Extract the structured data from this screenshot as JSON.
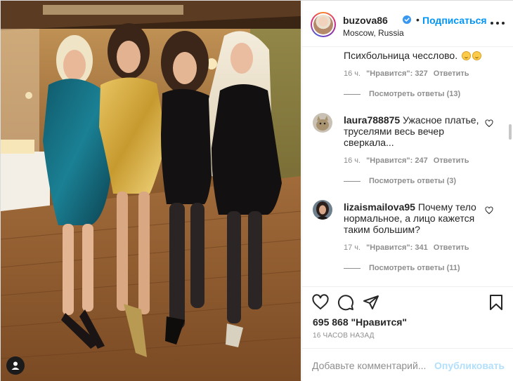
{
  "post": {
    "photo_alt": "Photo",
    "user_tag_icon": "person-icon"
  },
  "header": {
    "username": "buzova86",
    "verified_icon": "verified-badge-icon",
    "separator": "•",
    "follow_label": "Подписаться",
    "location": "Moscow, Russia",
    "more_icon": "more-horizontal-icon"
  },
  "comments": [
    {
      "text": "Психбольница чесслово.",
      "emojis": 2,
      "time": "16 ч.",
      "likes": "\"Нравится\": 327",
      "reply": "Ответить",
      "view_replies": "Посмотреть ответы (13)"
    },
    {
      "username": "laura788875",
      "text": "Ужасное платье, труселями весь вечер сверкала...",
      "time": "16 ч.",
      "likes": "\"Нравится\": 247",
      "reply": "Ответить",
      "view_replies": "Посмотреть ответы (3)"
    },
    {
      "username": "lizaismailova95",
      "text": "Почему тело нормальное, а лицо кажется таким большим?",
      "time": "17 ч.",
      "likes": "\"Нравится\": 341",
      "reply": "Ответить",
      "view_replies": "Посмотреть ответы (11)"
    }
  ],
  "actions": {
    "like_icon": "heart-icon",
    "comment_icon": "comment-icon",
    "share_icon": "share-icon",
    "save_icon": "bookmark-icon",
    "likes_count": "695 868",
    "likes_label": "\"Нравится\"",
    "posted_time": "16 ЧАСОВ НАЗАД"
  },
  "add_comment": {
    "placeholder": "Добавьте комментарий...",
    "post_label": "Опубликовать"
  },
  "colors": {
    "accent": "#0095f6",
    "post_disabled": "#b2dffc",
    "muted": "#8e8e8e",
    "text": "#262626"
  }
}
